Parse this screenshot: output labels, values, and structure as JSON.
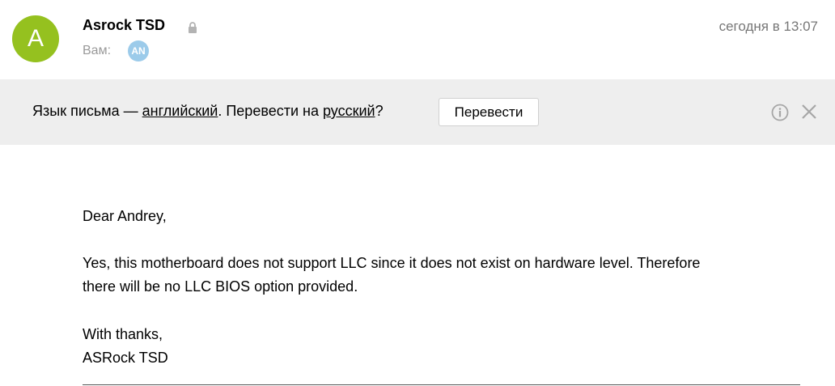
{
  "header": {
    "avatar_letter": "A",
    "sender_name": "Asrock TSD",
    "to_label": "Вам:",
    "recipient_initials": "AN",
    "timestamp": "сегодня в 13:07",
    "colors": {
      "avatar_bg": "#95c11f",
      "recipient_bg": "#9ccbea"
    }
  },
  "translate_bar": {
    "prefix": "Язык письма — ",
    "source_language": "английский",
    "middle": ". Перевести на ",
    "target_language": "русский",
    "suffix": "?",
    "button_label": "Перевести",
    "info_icon": "info-icon",
    "close_icon": "close-icon"
  },
  "message": {
    "greeting": "Dear Andrey,",
    "paragraph_line1": "Yes, this motherboard does not support LLC since it does not exist on hardware level. Therefore",
    "paragraph_line2": "there will be no LLC BIOS option provided.",
    "closing": "With thanks,",
    "signature": "ASRock TSD"
  }
}
